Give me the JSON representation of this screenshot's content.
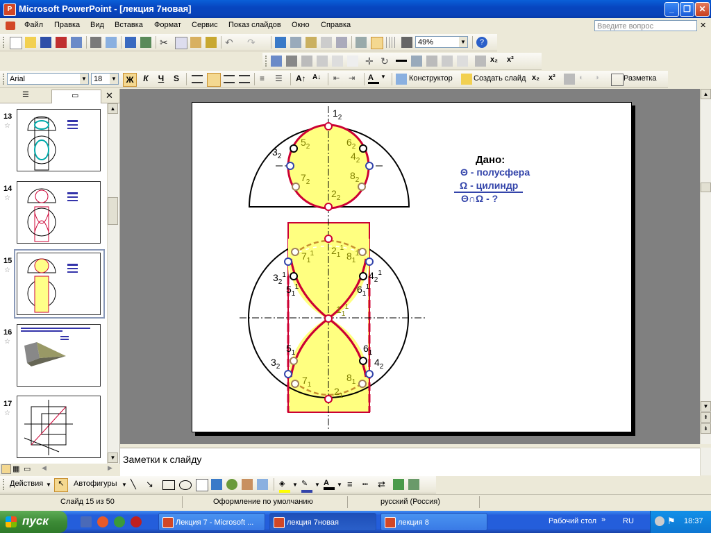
{
  "window": {
    "title": "Microsoft PowerPoint - [лекция 7новая]"
  },
  "menu": {
    "items": [
      "Файл",
      "Правка",
      "Вид",
      "Вставка",
      "Формат",
      "Сервис",
      "Показ слайдов",
      "Окно",
      "Справка"
    ],
    "ask_placeholder": "Введите вопрос"
  },
  "toolbar": {
    "zoom": "49%"
  },
  "format_toolbar": {
    "font": "Arial",
    "size": "18",
    "bold": "Ж",
    "italic": "К",
    "underline": "Ч",
    "shadow": "S",
    "constructor": "Конструктор",
    "new_slide": "Создать слайд",
    "layout": "Разметка"
  },
  "slides": [
    {
      "num": "13"
    },
    {
      "num": "14"
    },
    {
      "num": "15"
    },
    {
      "num": "16"
    },
    {
      "num": "17"
    }
  ],
  "slide": {
    "given_title": "Дано:",
    "given_lines": [
      "Θ - полусфера",
      "Ω - цилиндр",
      "Θ∩Ω  - ?"
    ],
    "labels": {
      "p12": "1",
      "p32": "3",
      "p52": "5",
      "p62": "6",
      "p42": "4",
      "p72": "7",
      "p82": "8",
      "p22": "2",
      "q71": "7",
      "q21": "2",
      "q81": "8",
      "q32": "3",
      "q42": "4",
      "q51": "5",
      "q61": "6",
      "q11": "1",
      "r51": "5",
      "r61": "6",
      "r32": "3",
      "r42": "4",
      "r71": "7",
      "r81": "8",
      "r21": "2"
    },
    "sub2": "2",
    "sub1": "1",
    "sup1": "1"
  },
  "notes": {
    "placeholder": "Заметки к слайду"
  },
  "drawing": {
    "actions": "Действия",
    "autoshapes": "Автофигуры"
  },
  "status": {
    "slide": "Слайд 15 из 50",
    "design": "Оформление по умолчанию",
    "lang": "русский (Россия)"
  },
  "taskbar": {
    "start": "пуск",
    "buttons": [
      "Лекция 7 - Microsoft ...",
      "лекция 7новая",
      "лекция 8"
    ],
    "desktop": "Рабочий стол",
    "lang": "RU",
    "time": "18:37"
  },
  "colors": {
    "fill_yellow": "#ffff80",
    "curve_red": "#cc0033",
    "point_blue": "#3344aa",
    "label_olive": "#808000"
  }
}
